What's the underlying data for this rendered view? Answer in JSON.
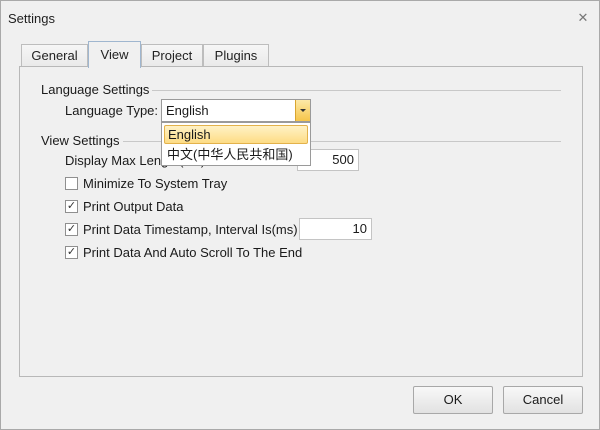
{
  "window": {
    "title": "Settings",
    "close_glyph": "✕"
  },
  "tabs": [
    {
      "label": "General"
    },
    {
      "label": "View"
    },
    {
      "label": "Project"
    },
    {
      "label": "Plugins"
    }
  ],
  "language": {
    "group_title": "Language Settings",
    "type_label": "Language Type:",
    "selected": "English",
    "options": [
      "English",
      "中文(中华人民共和国)"
    ]
  },
  "view": {
    "group_title": "View Settings",
    "max_length_label": "Display Max Length(KB):",
    "max_length_value": "500",
    "minimize_label": "Minimize To System Tray",
    "minimize_checked": false,
    "print_output_label": "Print Output Data",
    "print_output_checked": true,
    "timestamp_label": "Print Data Timestamp, Interval Is(ms)",
    "timestamp_checked": true,
    "timestamp_value": "10",
    "autoscroll_label": "Print Data And Auto Scroll To The End",
    "autoscroll_checked": true
  },
  "buttons": {
    "ok": "OK",
    "cancel": "Cancel"
  },
  "icons": {
    "check": "✓",
    "dropdown": "chevron-down-icon"
  }
}
